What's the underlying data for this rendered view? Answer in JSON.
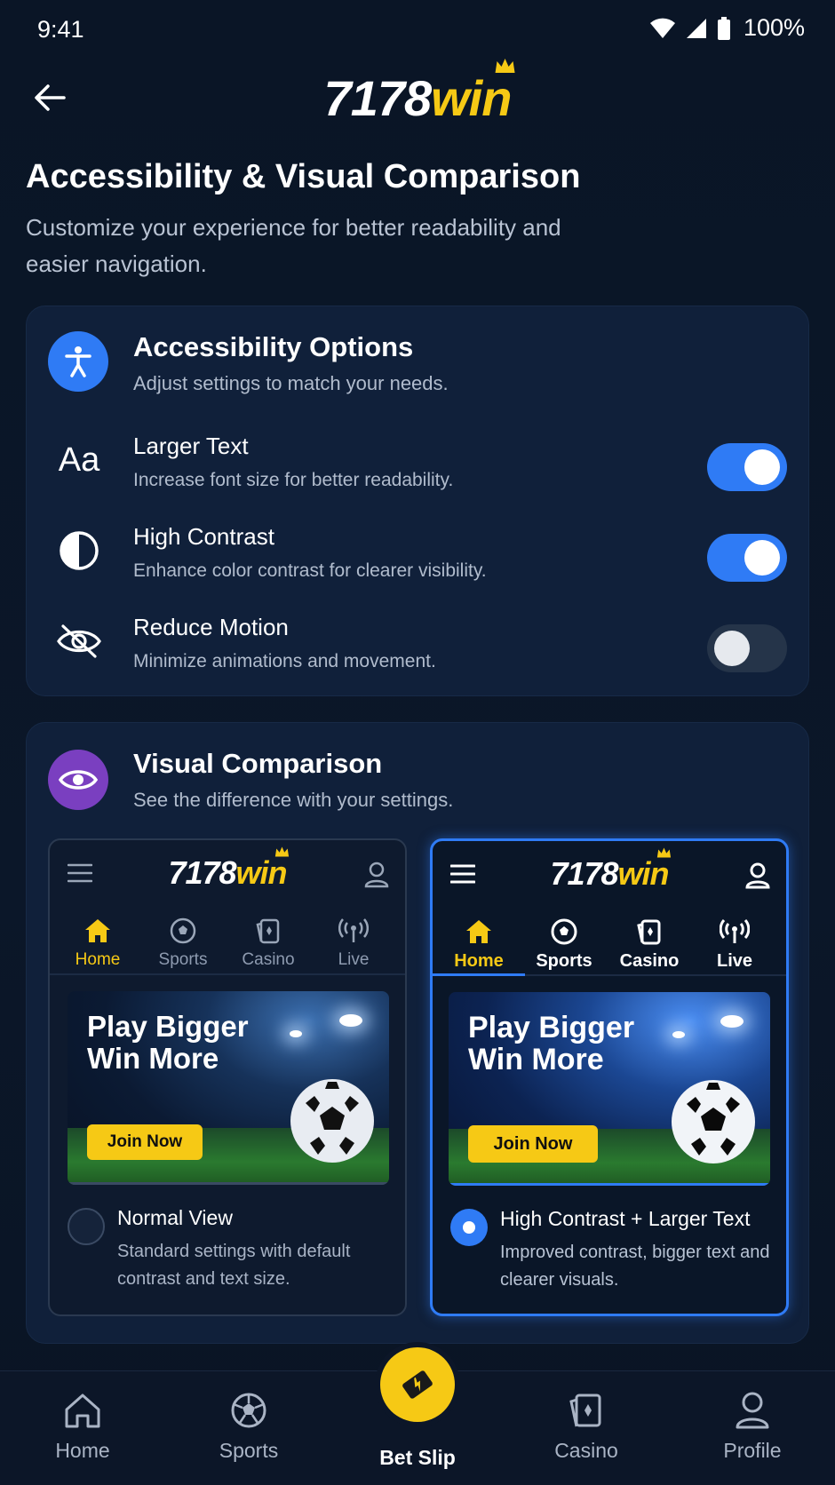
{
  "status": {
    "time": "9:41",
    "battery": "100%"
  },
  "header": {
    "logo_num": "7178",
    "logo_win": "win"
  },
  "page": {
    "title": "Accessibility & Visual Comparison",
    "subtitle": "Customize your experience for better readability and easier navigation."
  },
  "accessibility": {
    "title": "Accessibility Options",
    "subtitle": "Adjust settings to match your needs.",
    "options": [
      {
        "icon": "text-size-icon",
        "label": "Larger Text",
        "desc": "Increase font size for better readability.",
        "enabled": true
      },
      {
        "icon": "contrast-icon",
        "label": "High Contrast",
        "desc": "Enhance color contrast for clearer visibility.",
        "enabled": true
      },
      {
        "icon": "eye-off-icon",
        "label": "Reduce Motion",
        "desc": "Minimize animations and movement.",
        "enabled": false
      }
    ]
  },
  "comparison": {
    "title": "Visual Comparison",
    "subtitle": "See the difference with your settings.",
    "nav_labels": [
      "Home",
      "Sports",
      "Casino",
      "Live"
    ],
    "banner_title": "Play Bigger Win More",
    "banner_cta": "Join Now",
    "normal": {
      "label": "Normal View",
      "desc": "Standard settings with default contrast and text size.",
      "selected": false
    },
    "high_contrast": {
      "label": "High Contrast + Larger Text",
      "desc": "Improved contrast, bigger text and clearer visuals.",
      "selected": true
    }
  },
  "bottom_nav": {
    "items": [
      "Home",
      "Sports",
      "Bet Slip",
      "Casino",
      "Profile"
    ]
  },
  "colors": {
    "accent": "#2f7bf5",
    "brand_yellow": "#f6c915",
    "background": "#0b1628",
    "card": "#10203a"
  }
}
